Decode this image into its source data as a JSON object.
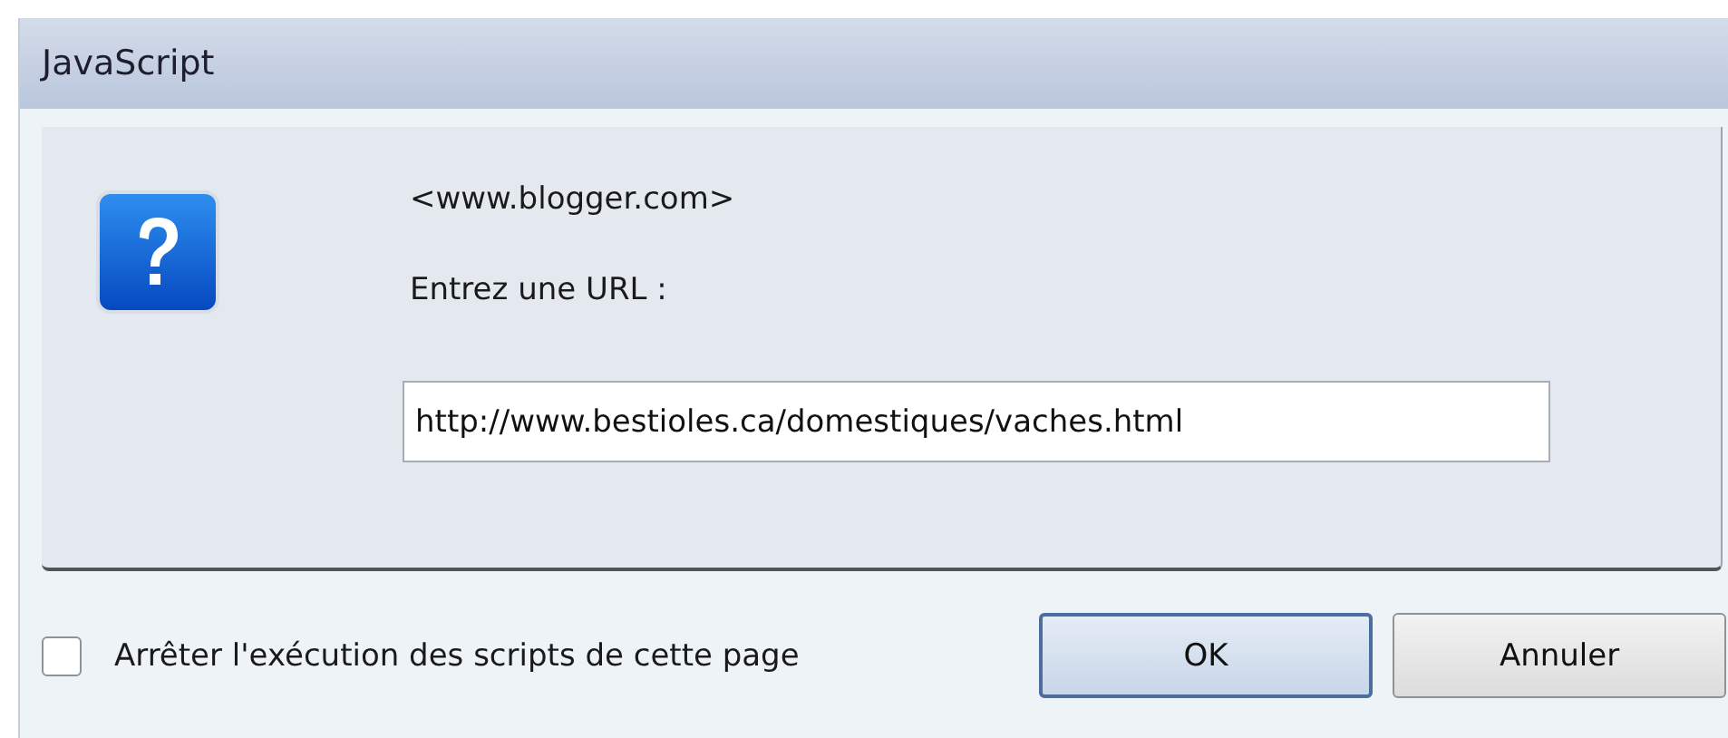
{
  "window": {
    "title": "JavaScript"
  },
  "message": {
    "origin": "<www.blogger.com>",
    "prompt": "Entrez une URL :"
  },
  "input": {
    "value": "http://www.bestioles.ca/domestiques/vaches.html"
  },
  "checkbox": {
    "label": "Arrêter l'exécution des scripts de cette page",
    "checked": false
  },
  "buttons": [
    {
      "label": "OK",
      "kind": "default"
    },
    {
      "label": "Annuler",
      "kind": "normal"
    }
  ]
}
